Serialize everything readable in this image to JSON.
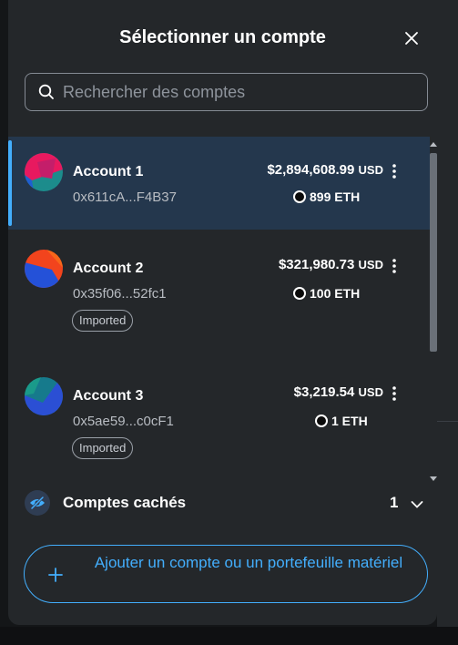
{
  "modal": {
    "title": "Sélectionner un compte",
    "close_icon": "close-icon"
  },
  "search": {
    "placeholder": "Rechercher des comptes",
    "value": "",
    "icon": "search-icon"
  },
  "accounts": [
    {
      "name": "Account 1",
      "address": "0x611cA...F4B37",
      "fiat_value": "$2,894,608.99",
      "fiat_currency": "USD",
      "eth_value": "899 ETH",
      "imported": false,
      "selected": true
    },
    {
      "name": "Account 2",
      "address": "0x35f06...52fc1",
      "fiat_value": "$321,980.73",
      "fiat_currency": "USD",
      "eth_value": "100 ETH",
      "imported": true,
      "tag": "Imported",
      "selected": false
    },
    {
      "name": "Account 3",
      "address": "0x5ae59...c0cF1",
      "fiat_value": "$3,219.54",
      "fiat_currency": "USD",
      "eth_value": "1 ETH",
      "imported": true,
      "tag": "Imported",
      "selected": false
    }
  ],
  "hidden_accounts": {
    "label": "Comptes cachés",
    "count": "1",
    "icon": "eye-slash-icon"
  },
  "add_account": {
    "label": "Ajouter un compte ou un portefeuille matériel",
    "icon": "plus-icon"
  },
  "colors": {
    "background": "#24272a",
    "selected_row": "#24374d",
    "accent": "#43aefc",
    "text_primary": "#ffffff",
    "text_secondary": "#b8bcc2"
  }
}
